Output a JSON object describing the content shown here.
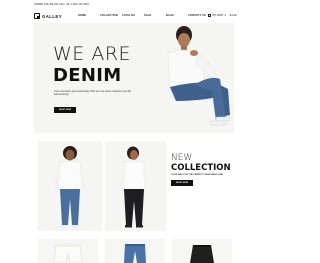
{
  "topbar": {
    "announcement": "ORDER ONLINE OR CALL US: 1-800-123-4567"
  },
  "brand": {
    "name": "GALLEY"
  },
  "nav": {
    "items": [
      {
        "label": "HOME"
      },
      {
        "label": "COLLECTION"
      },
      {
        "label": "CATALOG"
      },
      {
        "label": "SALE"
      },
      {
        "label": "BLOG"
      },
      {
        "label": "CONTACT US"
      }
    ]
  },
  "cart": {
    "label": "MY CART",
    "count": "0",
    "currency": "$ USD"
  },
  "hero": {
    "title_line1": "WE ARE",
    "title_line2": "DENIM",
    "text": "Your new look is just a click away. With our new denim collection you will look stunning!",
    "button": "SHOP NOW"
  },
  "collection": {
    "title_line1": "NEW",
    "title_line2": "COLLECTION",
    "subtitle": "YOUR WAY FOR THE PERFECT SEASONING FIND",
    "button": "SHOP NOW"
  },
  "icons": {
    "logo": "galley-logo-icon",
    "cart": "cart-icon"
  },
  "colors": {
    "accent": "#111111",
    "hero_bg": "#f5f5f4",
    "denim": "#3f5f8d"
  }
}
